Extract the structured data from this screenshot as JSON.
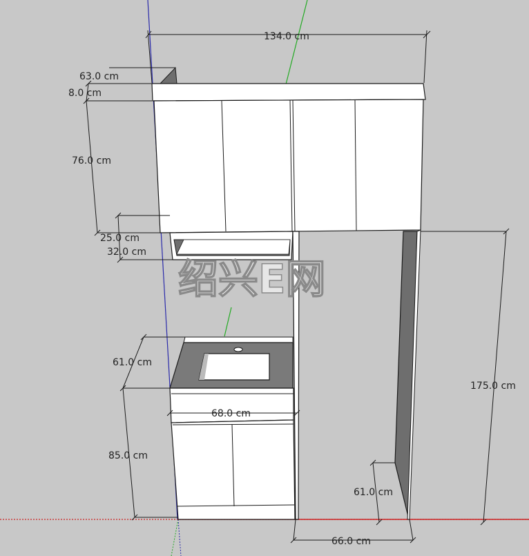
{
  "diagram": {
    "dimensions": {
      "total_width": "134.0 cm",
      "depth_top": "63.0 cm",
      "top_board": "8.0 cm",
      "upper_cabinet_height": "76.0 cm",
      "niche_gap": "25.0 cm",
      "niche_bottom": "32.0 cm",
      "counter_depth": "61.0 cm",
      "vanity_width": "68.0 cm",
      "vanity_height": "85.0 cm",
      "right_depth": "61.0 cm",
      "right_width": "66.0 cm",
      "right_height": "175.0 cm"
    },
    "watermark": "绍兴E网"
  },
  "colors": {
    "background": "#c8c8c8",
    "cabinet_face": "#ffffff",
    "panel_dark": "#6e6e6e",
    "countertop": "#7a7a7a",
    "line": "#1a1a1a",
    "axis_green": "#22aa22",
    "axis_blue": "#2a2aaa",
    "axis_red": "#cc2222"
  }
}
